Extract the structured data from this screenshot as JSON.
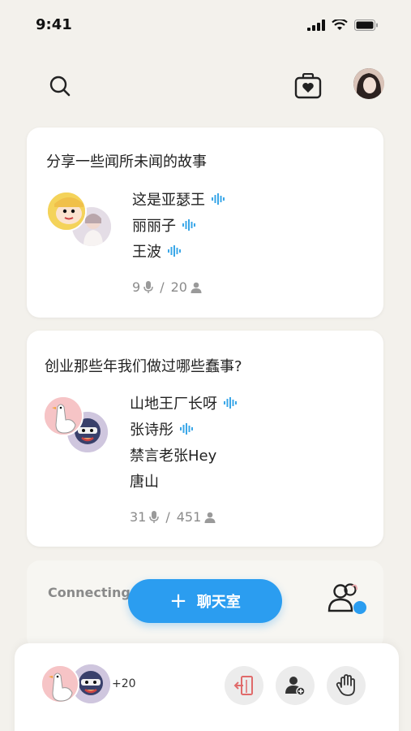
{
  "status_bar": {
    "time": "9:41"
  },
  "header": {
    "icons": [
      "search-icon",
      "heart-bag-icon",
      "avatar"
    ]
  },
  "rooms": [
    {
      "title": "分享一些闻所未闻的故事",
      "speakers": [
        {
          "name": "这是亚瑟王",
          "speaking": true
        },
        {
          "name": "丽丽子",
          "speaking": true
        },
        {
          "name": "王波",
          "speaking": true
        }
      ],
      "speaker_count": "9",
      "listener_sep": "/",
      "listener_count": "20"
    },
    {
      "title": "创业那些年我们做过哪些蠢事?",
      "speakers": [
        {
          "name": "山地王厂长呀",
          "speaking": true
        },
        {
          "name": "张诗彤",
          "speaking": true
        },
        {
          "name": "禁言老张Hey",
          "speaking": false
        },
        {
          "name": "唐山",
          "speaking": false
        }
      ],
      "speaker_count": "31",
      "listener_sep": "/",
      "listener_count": "451"
    },
    {
      "title": "Connecting"
    }
  ],
  "fab": {
    "label": "聊天室",
    "plus": "+"
  },
  "bottom_sheet": {
    "extra_count": "+20"
  },
  "colors": {
    "accent": "#2b9df0",
    "wave": "#3aa7e8",
    "background": "#f3f1ec"
  }
}
